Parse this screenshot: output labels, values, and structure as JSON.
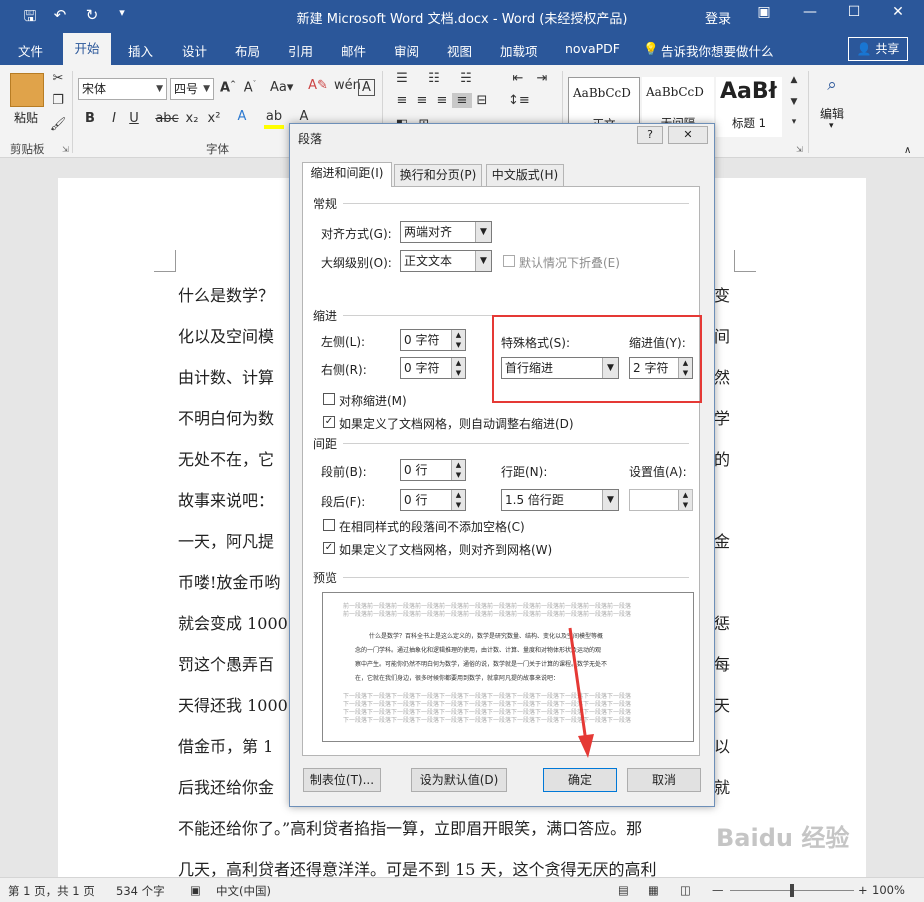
{
  "title_bar": {
    "title": "新建 Microsoft Word 文档.docx - Word (未经授权产品)",
    "login": "登录",
    "save_icon": "save-icon",
    "undo_icon": "undo-icon",
    "redo_icon": "redo-icon",
    "more_icon": "qat-more-icon"
  },
  "tabs": [
    "文件",
    "开始",
    "插入",
    "设计",
    "布局",
    "引用",
    "邮件",
    "审阅",
    "视图",
    "加载项",
    "novaPDF"
  ],
  "tell_me": "告诉我你想要做什么",
  "share": "共享",
  "ribbon": {
    "paste": "粘贴",
    "clipboard": "剪贴板",
    "font_name": "宋体",
    "font_size": "四号",
    "font_group": "字体",
    "styles": [
      {
        "sample": "AaBbCcD",
        "name": "正文"
      },
      {
        "sample": "AaBbCcD",
        "name": "无间隔"
      },
      {
        "sample": "AaBł",
        "name": "标题 1"
      }
    ],
    "edit": "编辑",
    "format_buttons": [
      "B",
      "I",
      "U",
      "abc",
      "x₂",
      "x²"
    ]
  },
  "document": {
    "lines": [
      {
        "left": "什么是数学？",
        "right": "变"
      },
      {
        "left": "化以及空间模",
        "right": "间"
      },
      {
        "left": "由计数、计算",
        "right": "然"
      },
      {
        "left": "不明白何为数",
        "right": "学"
      },
      {
        "left": "无处不在，它",
        "right": "的"
      },
      {
        "left": "故事来说吧：",
        "right": ""
      },
      {
        "left": "一天，阿凡提",
        "right": "金"
      },
      {
        "left": "币喽!放金币哟",
        "right": ""
      },
      {
        "left": "就会变成 1000",
        "right": "惩"
      },
      {
        "left": "罚这个愚弄百",
        "right": "每"
      },
      {
        "left": "天得还我 1000",
        "right": "天"
      },
      {
        "left": "借金币，第 1",
        "right": "以"
      },
      {
        "left": "后我还给你金",
        "right": "就"
      },
      {
        "left": "不能还给你了。”高利贷者掐指一算，立即眉开眼笑，满口答应。那",
        "right": ""
      },
      {
        "left": "几天，高利贷者还得意洋洋。可是不到 15 天，这个贪得无厌的高利",
        "right": ""
      }
    ]
  },
  "status": {
    "page": "第 1 页，共 1 页",
    "words": "534 个字",
    "lang": "中文(中国)",
    "zoom": "100%",
    "zoom_level": 1.0
  },
  "dialog": {
    "title": "段落",
    "help": "?",
    "close": "✕",
    "tabs": [
      "缩进和间距(I)",
      "换行和分页(P)",
      "中文版式(H)"
    ],
    "general": "常规",
    "align_label": "对齐方式(G):",
    "align_value": "两端对齐",
    "outline_label": "大纲级别(O):",
    "outline_value": "正文文本",
    "collapse_label": "默认情况下折叠(E)",
    "indent": "缩进",
    "left_label": "左侧(L):",
    "left_value": "0 字符",
    "right_label": "右侧(R):",
    "right_value": "0 字符",
    "special_label": "特殊格式(S):",
    "special_value": "首行缩进",
    "indent_by_label": "缩进值(Y):",
    "indent_by_value": "2 字符",
    "mirror_label": "对称缩进(M)",
    "auto_right_label": "如果定义了文档网格，则自动调整右缩进(D)",
    "spacing": "间距",
    "before_label": "段前(B):",
    "before_value": "0 行",
    "after_label": "段后(F):",
    "after_value": "0 行",
    "line_label": "行距(N):",
    "line_value": "1.5 倍行距",
    "at_label": "设置值(A):",
    "at_value": "",
    "no_space_label": "在相同样式的段落间不添加空格(C)",
    "snap_grid_label": "如果定义了文档网格，则对齐到网格(W)",
    "preview": "预览",
    "preview_prev": "前一段落前一段落前一段落前一段落前一段落前一段落前一段落前一段落前一段落前一段落前一段落前一段落",
    "preview_text": [
      "什么是数学？百科全书上是这么定义的，数学是研究数量、结构、变化以及空间模型等概",
      "念的一门学科。通过抽象化和逻辑推理的使用，由计数、计算、量度和对物体形状及运动的观",
      "察中产生。可能你仍然不明白何为数学，通俗的说，数学就是一门关于计算的课程。数学无处不",
      "在，它就在我们身边，很多时候你都要用到数学，就拿阿凡提的故事来说吧："
    ],
    "preview_next": "下一段落下一段落下一段落下一段落下一段落下一段落下一段落下一段落下一段落下一段落下一段落下一段落",
    "tabs_btn": "制表位(T)...",
    "default_btn": "设为默认值(D)",
    "ok_btn": "确定",
    "cancel_btn": "取消"
  }
}
